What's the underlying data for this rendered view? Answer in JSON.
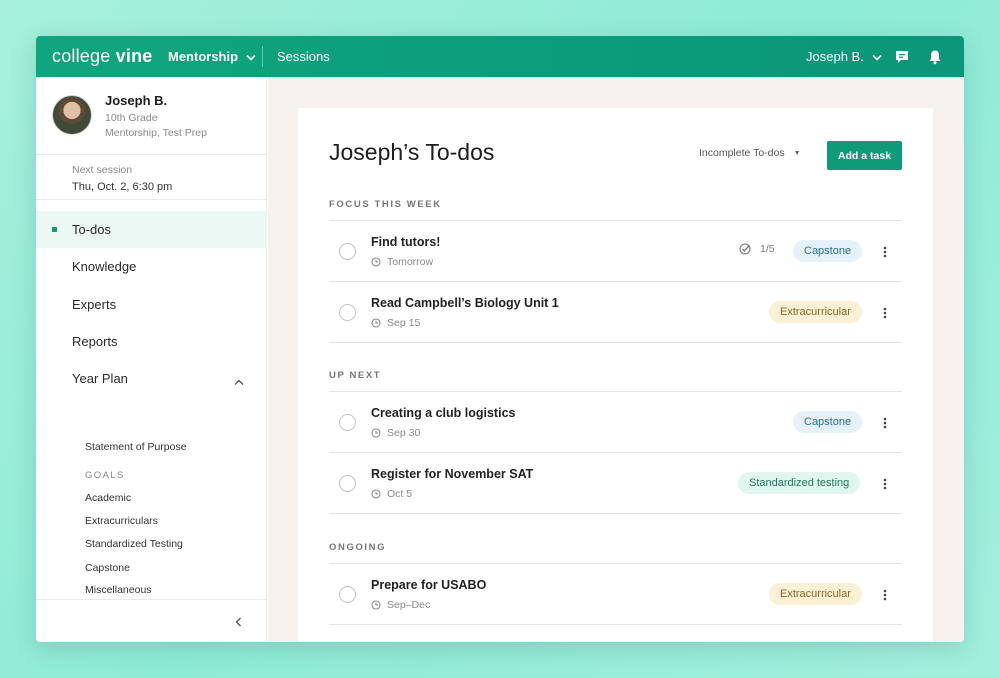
{
  "brand": {
    "logo_light": "college",
    "logo_bold": "vine",
    "accent": "#0f9b78"
  },
  "topbar": {
    "mentorship_label": "Mentorship",
    "sessions_label": "Sessions",
    "user_label": "Joseph B.",
    "icons": [
      "chat-icon",
      "bell-icon"
    ]
  },
  "sidebar": {
    "profile": {
      "name": "Joseph B.",
      "grade": "10th Grade",
      "tags": "Mentorship, Test Prep"
    },
    "next_session": {
      "label": "Next session",
      "value": "Thu, Oct. 2, 6:30 pm"
    },
    "nav": [
      {
        "label": "To-dos",
        "active": true
      },
      {
        "label": "Knowledge"
      },
      {
        "label": "Experts"
      },
      {
        "label": "Reports"
      },
      {
        "label": "Year Plan",
        "expanded": true
      }
    ],
    "year_plan": {
      "statement": "Statement of Purpose",
      "goals_label": "GOALS",
      "goals": [
        "Academic",
        "Extracurriculars",
        "Standardized Testing",
        "Capstone",
        "Miscellaneous"
      ]
    }
  },
  "main": {
    "title": "Joseph’s To-dos",
    "filter": "Incomplete To-dos",
    "add_task_label": "Add a task",
    "sections": [
      {
        "label": "FOCUS THIS WEEK",
        "tasks": [
          {
            "title": "Find tutors!",
            "due": "Tomorrow",
            "progress": "1/5",
            "tag": "Capstone",
            "tag_type": "capstone"
          },
          {
            "title": "Read Campbell’s Biology Unit 1",
            "due": "Sep 15",
            "tag": "Extracurricular",
            "tag_type": "extracurricular"
          }
        ]
      },
      {
        "label": "UP NEXT",
        "tasks": [
          {
            "title": "Creating a club logistics",
            "due": "Sep 30",
            "tag": "Capstone",
            "tag_type": "capstone"
          },
          {
            "title": "Register for November SAT",
            "due": "Oct 5",
            "tag": "Standardized testing",
            "tag_type": "testing"
          }
        ]
      },
      {
        "label": "ONGOING",
        "tasks": [
          {
            "title": "Prepare for USABO",
            "due": "Sep–Dec",
            "tag": "Extracurricular",
            "tag_type": "extracurricular"
          }
        ]
      }
    ]
  }
}
